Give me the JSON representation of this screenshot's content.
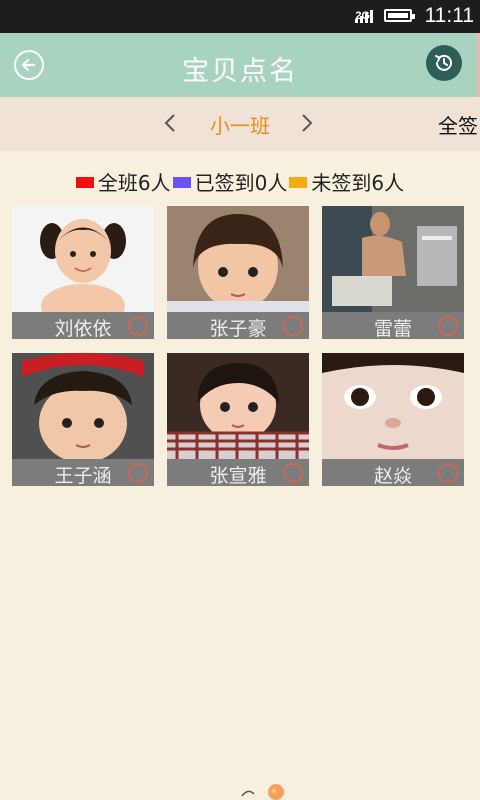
{
  "status_bar": {
    "network": "2G",
    "time": "11:11"
  },
  "header": {
    "title": "宝贝点名",
    "back_icon": "back-arrow-icon",
    "history_icon": "history-clock-icon"
  },
  "class_selector": {
    "prev_icon": "chevron-left-icon",
    "next_icon": "chevron-right-icon",
    "class_name": "小一班",
    "sign_all_label": "全签"
  },
  "legend": [
    {
      "label": "全班6人",
      "color": "#ee1111"
    },
    {
      "label": "已签到0人",
      "color": "#6a52ee"
    },
    {
      "label": "未签到6人",
      "color": "#f4aa14"
    }
  ],
  "students": [
    {
      "name": "刘依依",
      "checked": false
    },
    {
      "name": "张子豪",
      "checked": false
    },
    {
      "name": "雷蕾",
      "checked": false
    },
    {
      "name": "王子涵",
      "checked": false
    },
    {
      "name": "张宣雅",
      "checked": false
    },
    {
      "name": "赵焱",
      "checked": false
    }
  ],
  "colors": {
    "header_bg": "#a8d3c0",
    "selector_bg": "#f0e2d6",
    "page_bg": "#f8f0df",
    "accent_orange": "#f08a17"
  }
}
